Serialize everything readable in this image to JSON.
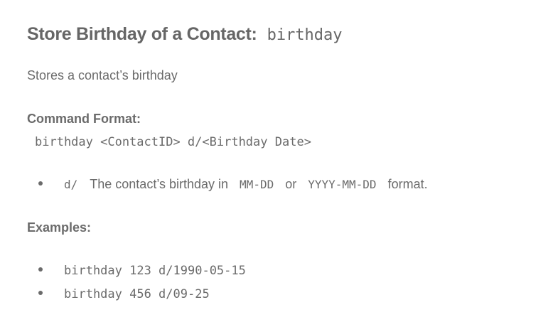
{
  "heading": {
    "title": "Store Birthday of a Contact:",
    "command": "birthday"
  },
  "description": "Stores a contact’s birthday",
  "command_format": {
    "label": "Command Format:",
    "syntax": "birthday <ContactID> d/<Birthday Date>"
  },
  "parameters": [
    {
      "prefix": "d/",
      "text_before": "The contact’s birthday in",
      "format_1": "MM-DD",
      "connector": "or",
      "format_2": "YYYY-MM-DD",
      "text_after": "format."
    }
  ],
  "examples": {
    "label": "Examples:",
    "items": [
      "birthday 123 d/1990-05-15",
      "birthday 456 d/09-25"
    ]
  }
}
